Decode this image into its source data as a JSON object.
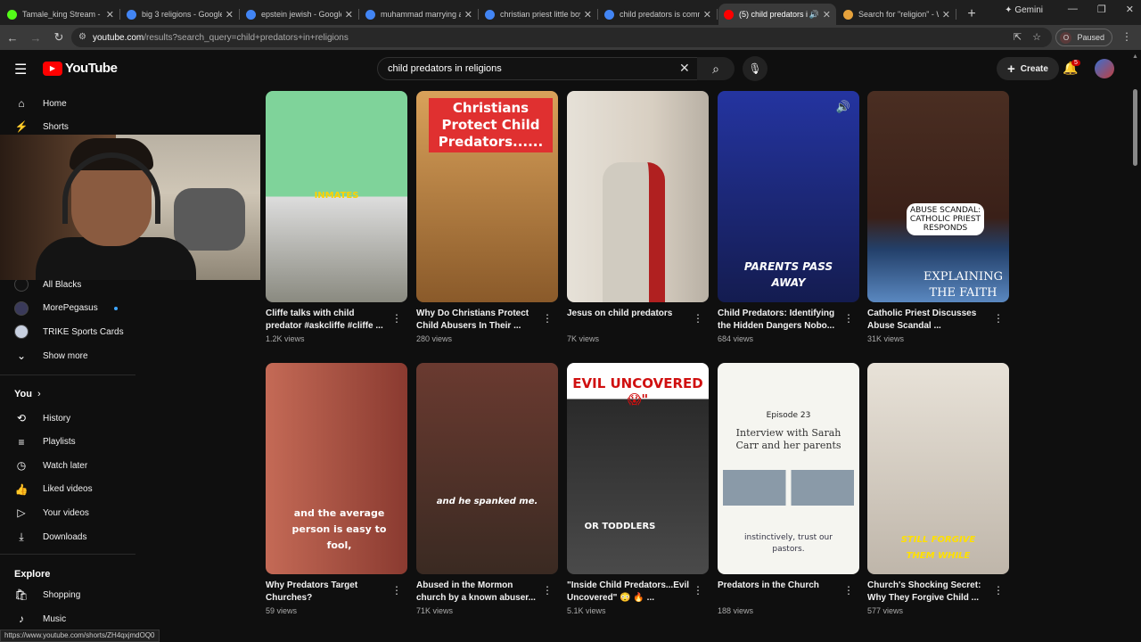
{
  "browser": {
    "tabs": [
      {
        "title": "Tamale_king Stream - W",
        "color": "#53fc18"
      },
      {
        "title": "big 3 religions - Google",
        "color": "#4285f4"
      },
      {
        "title": "epstein jewish - Google",
        "color": "#4285f4"
      },
      {
        "title": "muhammad marrying a",
        "color": "#4285f4"
      },
      {
        "title": "christian priest little boy",
        "color": "#4285f4"
      },
      {
        "title": "child predators is comm",
        "color": "#4285f4"
      },
      {
        "title": "(5) child predators i",
        "color": "#ff0000"
      },
      {
        "title": "Search for \"religion\" - W",
        "color": "#e6a23c"
      }
    ],
    "gemini_label": "Gemini",
    "url_host": "youtube.com",
    "url_rest": "/results?search_query=child+predators+in+religions",
    "profile_initial": "O",
    "profile_status": "Paused",
    "status_url": "https://www.youtube.com/shorts/ZH4qxjmdOQ0"
  },
  "header": {
    "logo_text": "YouTube",
    "search_value": "child predators in religions",
    "create_label": "Create",
    "notification_count": "5"
  },
  "sidebar": {
    "top": [
      {
        "label": "Home",
        "icon": "home-icon"
      },
      {
        "label": "Shorts",
        "icon": "shorts-icon"
      }
    ],
    "subscriptions": [
      {
        "label": "All Blacks",
        "color": "#111111",
        "live": false
      },
      {
        "label": "MorePegasus",
        "color": "#3a3a5a",
        "live": true
      },
      {
        "label": "TRIKE Sports Cards",
        "color": "#c8d0e0",
        "live": false
      }
    ],
    "show_more": "Show more",
    "you_heading": "You",
    "you_items": [
      {
        "label": "History",
        "icon": "history-icon"
      },
      {
        "label": "Playlists",
        "icon": "playlists-icon"
      },
      {
        "label": "Watch later",
        "icon": "watch-later-icon"
      },
      {
        "label": "Liked videos",
        "icon": "like-icon"
      },
      {
        "label": "Your videos",
        "icon": "your-videos-icon"
      },
      {
        "label": "Downloads",
        "icon": "download-icon"
      }
    ],
    "explore_heading": "Explore",
    "explore_items": [
      {
        "label": "Shopping",
        "icon": "shopping-icon"
      },
      {
        "label": "Music",
        "icon": "music-icon"
      }
    ]
  },
  "videos": [
    {
      "title": "Cliffe talks with child predator #askcliffe #cliffe ...",
      "views": "1.2K views",
      "overlay": "INMATES",
      "bg": "#6fbf7f"
    },
    {
      "title": "Why Do Christians Protect Child Abusers In Their ...",
      "views": "280 views",
      "overlay": "Christians Protect Child Predators......",
      "bg": "#c98a3a"
    },
    {
      "title": "Jesus on child predators",
      "views": "7K views",
      "overlay": "",
      "bg": "#d8d2c6"
    },
    {
      "title": "Child Predators: Identifying the Hidden Dangers Nobo...",
      "views": "684 views",
      "overlay": "PARENTS PASS AWAY",
      "bg": "#2c3e9a"
    },
    {
      "title": "Catholic Priest Discusses Abuse Scandal ...",
      "views": "31K views",
      "overlay": "ABUSE SCANDAL: CATHOLIC PRIEST RESPONDS",
      "overlay2": "EXPLAINING THE FAITH",
      "bg": "#3a2a22"
    },
    {
      "title": "Why Predators Target Churches?",
      "views": "59 views",
      "overlay": "and the average person is easy to fool,",
      "bg": "#a85a4a"
    },
    {
      "title": "Abused in the Mormon church by a known abuser...",
      "views": "71K views",
      "overlay": "and he spanked me.",
      "bg": "#5a4a40"
    },
    {
      "title": "\"Inside Child Predators...Evil Uncovered\" 😳 🔥 ...",
      "views": "5.1K views",
      "overlay": "EVIL UNCOVERED😱\"",
      "overlay2": "OR TODDLERS",
      "bg": "#3a3a3a"
    },
    {
      "title": "Predators in the Church",
      "views": "188 views",
      "overlay": "Episode 23",
      "overlay2": "Interview with Sarah Carr and her parents",
      "overlay3": "instinctively, trust our pastors.",
      "bg": "#f4f4f0"
    },
    {
      "title": "Church's Shocking Secret: Why They Forgive Child ...",
      "views": "577 views",
      "overlay": "STILL FORGIVE THEM WHILE",
      "bg": "#8a7a6a"
    }
  ]
}
